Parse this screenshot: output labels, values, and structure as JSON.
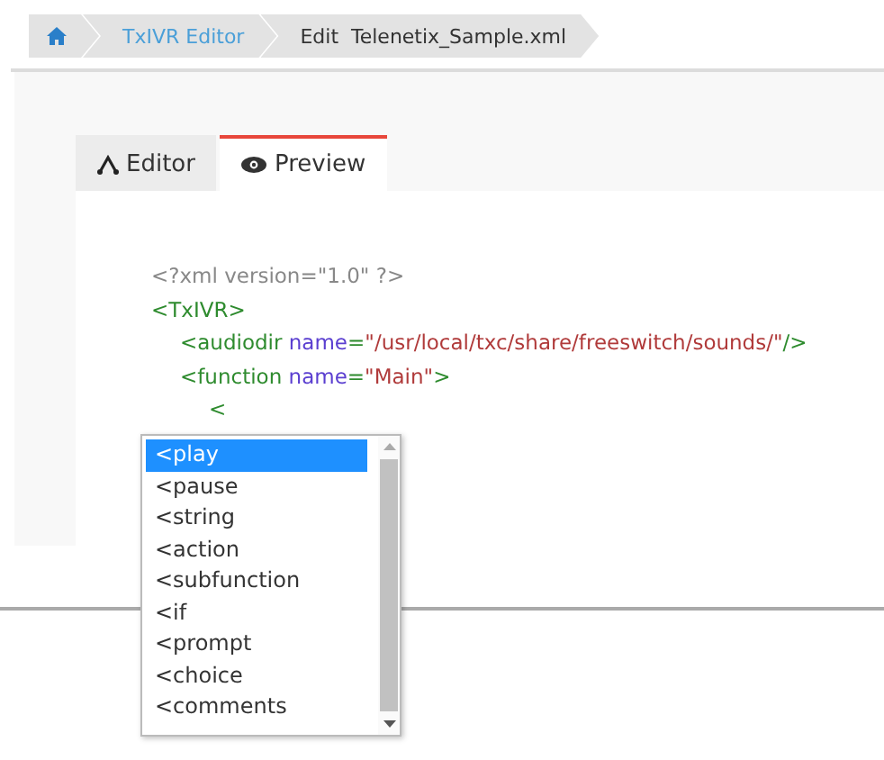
{
  "breadcrumb": [
    {
      "kind": "home"
    },
    {
      "kind": "link",
      "label": "TxIVR Editor"
    },
    {
      "kind": "current",
      "label": "Edit  Telenetix_Sample.xml"
    }
  ],
  "tabs": [
    {
      "kind": "editor",
      "label": "Editor",
      "selected": false
    },
    {
      "kind": "preview",
      "label": "Preview",
      "selected": true
    }
  ],
  "code_lines": [
    {
      "tokens": [
        {
          "kind": "decl",
          "text": "<?xml version=\"1.0\" ?>"
        }
      ]
    },
    {
      "tokens": [
        {
          "kind": "tag",
          "text": "<TxIVR>"
        }
      ],
      "children": [
        {
          "tokens": [
            {
              "kind": "tag",
              "text": "<audiodir"
            },
            {
              "kind": "attr",
              "text": " name"
            },
            {
              "kind": "tag",
              "text": "="
            },
            {
              "kind": "value",
              "text": "\"/usr/local/txc/share/freeswitch/sounds/\""
            },
            {
              "kind": "tag",
              "text": "/>"
            }
          ]
        },
        {
          "tokens": [
            {
              "kind": "tag",
              "text": "<function"
            },
            {
              "kind": "attr",
              "text": " name"
            },
            {
              "kind": "tag",
              "text": "="
            },
            {
              "kind": "value",
              "text": "\"Main\""
            },
            {
              "kind": "tag",
              "text": ">"
            }
          ],
          "children": [
            {
              "tokens": [
                {
                  "kind": "tag",
                  "text": "<"
                }
              ]
            }
          ]
        }
      ]
    }
  ],
  "autocomplete": [
    {
      "label": "<play",
      "selected": true
    },
    {
      "label": "<pause",
      "selected": false
    },
    {
      "label": "<string",
      "selected": false
    },
    {
      "label": "<action",
      "selected": false
    },
    {
      "label": "<subfunction",
      "selected": false
    },
    {
      "label": "<if",
      "selected": false
    },
    {
      "label": "<prompt",
      "selected": false
    },
    {
      "label": "<choice",
      "selected": false
    },
    {
      "label": "<comments",
      "selected": false
    }
  ]
}
